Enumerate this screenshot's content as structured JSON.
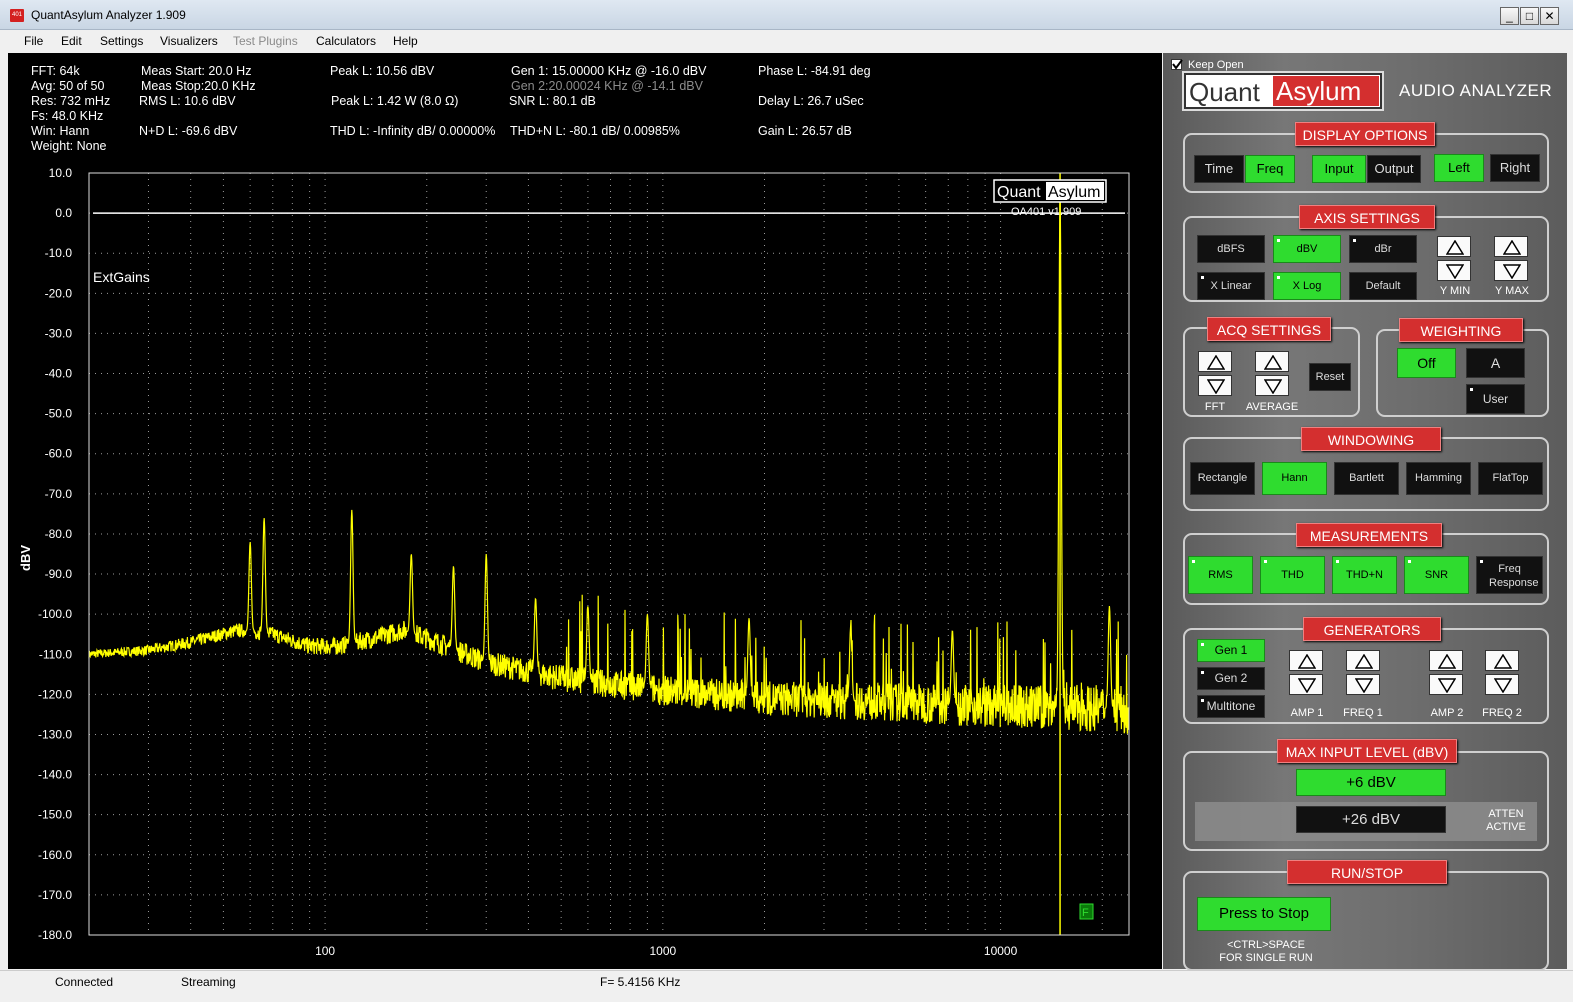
{
  "window": {
    "title": "QuantAsylum Analyzer 1.909",
    "icon_text": "401",
    "min": "_",
    "max": "□",
    "close": "✕"
  },
  "menu": [
    {
      "label": "File"
    },
    {
      "label": "Edit"
    },
    {
      "label": "Settings"
    },
    {
      "label": "Visualizers"
    },
    {
      "label": "Test Plugins"
    },
    {
      "label": "Calculators"
    },
    {
      "label": "Help"
    }
  ],
  "info": {
    "col1": [
      "FFT: 64k",
      "Avg: 50 of 50",
      "Res: 732 mHz",
      "Fs: 48.0 KHz",
      "Win: Hann",
      "Weight: None"
    ],
    "meas_start": "Meas Start: 20.0 Hz",
    "meas_stop": "Meas Stop:20.0 KHz",
    "rms": "RMS L: 10.6 dBV",
    "nd": "N+D L: -69.6 dBV",
    "peak": "Peak L: 10.56 dBV",
    "peak_w": "Peak L: 1.42 W (8.0 Ω)",
    "thd": "THD L: -Infinity dB/ 0.00000%",
    "gen1": "Gen 1: 15.00000 KHz @ -16.0  dBV",
    "gen2": "Gen 2:20.00024 KHz @ -14.1  dBV",
    "snr": "SNR L: 80.1 dB",
    "thdn": "THD+N L: -80.1 dB/ 0.00985%",
    "phase": "Phase L: -84.91 deg",
    "delay": "Delay L: 26.7 uSec",
    "gain": "Gain L: 26.57 dB"
  },
  "chart_data": {
    "type": "line",
    "ylabel": "dBV",
    "ylim": [
      -180,
      10
    ],
    "y_ticks": [
      "10.0",
      "0.0",
      "-10.0",
      "-20.0",
      "-30.0",
      "-40.0",
      "-50.0",
      "-60.0",
      "-70.0",
      "-80.0",
      "-90.0",
      "-100.0",
      "-110.0",
      "-120.0",
      "-130.0",
      "-140.0",
      "-150.0",
      "-160.0",
      "-170.0",
      "-180.0"
    ],
    "xscale": "log",
    "xlim": [
      20,
      24000
    ],
    "x_ticks": [
      "100",
      "1000",
      "10000"
    ],
    "grid": true,
    "annotation": "ExtGains",
    "logo_left": "Quant",
    "logo_right": "Asylum",
    "version": "OA401 v1.909",
    "flag": "F",
    "reference_line_db": 0,
    "marker_hz": 15000,
    "line_color": "#ffff00",
    "noise_floor": [
      [
        20,
        -110
      ],
      [
        30,
        -109
      ],
      [
        40,
        -107
      ],
      [
        55,
        -104
      ],
      [
        70,
        -105
      ],
      [
        90,
        -108
      ],
      [
        110,
        -108
      ],
      [
        140,
        -106
      ],
      [
        170,
        -104
      ],
      [
        200,
        -106
      ],
      [
        300,
        -112
      ],
      [
        500,
        -116
      ],
      [
        1000,
        -119
      ],
      [
        2000,
        -121
      ],
      [
        5000,
        -122
      ],
      [
        10000,
        -123
      ],
      [
        20000,
        -123.5
      ],
      [
        24000,
        -124
      ]
    ],
    "peaks": [
      [
        60,
        -82
      ],
      [
        66,
        -76
      ],
      [
        120,
        -74
      ],
      [
        180,
        -85
      ],
      [
        240,
        -88
      ],
      [
        300,
        -85
      ],
      [
        420,
        -96
      ],
      [
        600,
        -98
      ],
      [
        900,
        -100
      ],
      [
        1800,
        -101
      ],
      [
        3600,
        -103
      ],
      [
        7200,
        -104
      ],
      [
        15000,
        5
      ],
      [
        21000,
        -98
      ]
    ]
  },
  "right_panel": {
    "keep_open": "Keep Open",
    "brand_left": "Quant",
    "brand_right": "Asylum",
    "brand_sub": "AUDIO ANALYZER",
    "display": {
      "title": "DISPLAY OPTIONS",
      "buttons": [
        {
          "label": "Time",
          "on": false
        },
        {
          "label": "Freq",
          "on": true
        },
        {
          "label": "Input",
          "on": true
        },
        {
          "label": "Output",
          "on": false
        },
        {
          "label": "Left",
          "on": true
        },
        {
          "label": "Right",
          "on": false
        }
      ]
    },
    "axis": {
      "title": "AXIS SETTINGS",
      "row1": [
        {
          "label": "dBFS",
          "on": false
        },
        {
          "label": "dBV",
          "on": true
        },
        {
          "label": "dBr",
          "on": false
        }
      ],
      "row2": [
        {
          "label": "X Linear",
          "on": false
        },
        {
          "label": "X Log",
          "on": true
        },
        {
          "label": "Default",
          "on": false
        }
      ],
      "ymin": "Y MIN",
      "ymax": "Y MAX"
    },
    "acq": {
      "title": "ACQ SETTINGS",
      "fft": "FFT",
      "average": "AVERAGE",
      "reset": "Reset"
    },
    "weighting": {
      "title": "WEIGHTING",
      "off": "Off",
      "a": "A",
      "user": "User"
    },
    "windowing": {
      "title": "WINDOWING",
      "buttons": [
        {
          "label": "Rectangle",
          "on": false
        },
        {
          "label": "Hann",
          "on": true
        },
        {
          "label": "Bartlett",
          "on": false
        },
        {
          "label": "Hamming",
          "on": false
        },
        {
          "label": "FlatTop",
          "on": false
        }
      ]
    },
    "measurements": {
      "title": "MEASUREMENTS",
      "buttons": [
        {
          "label": "RMS",
          "on": true
        },
        {
          "label": "THD",
          "on": true
        },
        {
          "label": "THD+N",
          "on": true
        },
        {
          "label": "SNR",
          "on": true
        },
        {
          "label": "Freq Response",
          "on": false
        }
      ]
    },
    "generators": {
      "title": "GENERATORS",
      "gen1": "Gen 1",
      "gen2": "Gen 2",
      "multitone": "Multitone",
      "amp1": "AMP 1",
      "freq1": "FREQ 1",
      "amp2": "AMP 2",
      "freq2": "FREQ 2"
    },
    "maxinput": {
      "title": "MAX INPUT LEVEL (dBV)",
      "low": "+6 dBV",
      "high": "+26 dBV",
      "atten1": "ATTEN",
      "atten2": "ACTIVE"
    },
    "runstop": {
      "title": "RUN/STOP",
      "button": "Press to Stop",
      "hint1": "<CTRL>SPACE",
      "hint2": "FOR SINGLE RUN"
    }
  },
  "status": {
    "connected": "Connected",
    "streaming": "Streaming",
    "freq": "F= 5.4156 KHz"
  }
}
